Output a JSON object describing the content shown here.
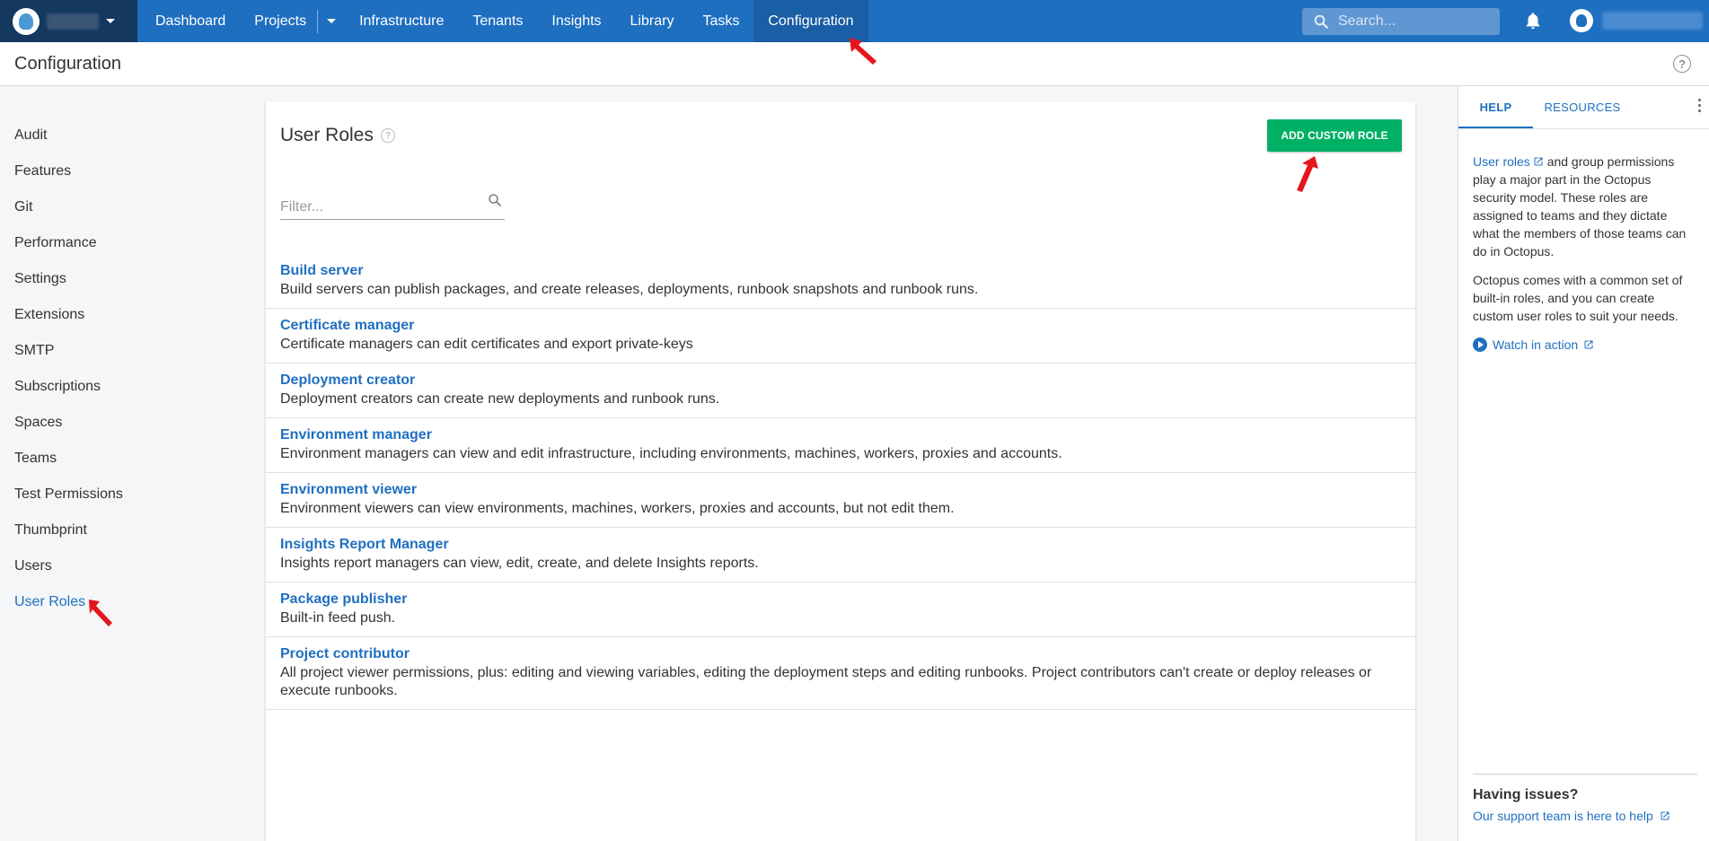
{
  "nav": {
    "items": [
      "Dashboard",
      "Projects",
      "Infrastructure",
      "Tenants",
      "Insights",
      "Library",
      "Tasks",
      "Configuration"
    ],
    "active": "Configuration",
    "search_placeholder": "Search..."
  },
  "header": {
    "title": "Configuration"
  },
  "sidebar": {
    "items": [
      "Audit",
      "Features",
      "Git",
      "Performance",
      "Settings",
      "Extensions",
      "SMTP",
      "Subscriptions",
      "Spaces",
      "Teams",
      "Test Permissions",
      "Thumbprint",
      "Users",
      "User Roles"
    ],
    "active": "User Roles"
  },
  "main": {
    "title": "User Roles",
    "add_button": "ADD CUSTOM ROLE",
    "filter_placeholder": "Filter...",
    "roles": [
      {
        "name": "Build server",
        "description": "Build servers can publish packages, and create releases, deployments, runbook snapshots and runbook runs."
      },
      {
        "name": "Certificate manager",
        "description": "Certificate managers can edit certificates and export private-keys"
      },
      {
        "name": "Deployment creator",
        "description": "Deployment creators can create new deployments and runbook runs."
      },
      {
        "name": "Environment manager",
        "description": "Environment managers can view and edit infrastructure, including environments, machines, workers, proxies and accounts."
      },
      {
        "name": "Environment viewer",
        "description": "Environment viewers can view environments, machines, workers, proxies and accounts, but not edit them."
      },
      {
        "name": "Insights Report Manager",
        "description": "Insights report managers can view, edit, create, and delete Insights reports."
      },
      {
        "name": "Package publisher",
        "description": "Built-in feed push."
      },
      {
        "name": "Project contributor",
        "description": "All project viewer permissions, plus: editing and viewing variables, editing the deployment steps and editing runbooks. Project contributors can't create or deploy releases or execute runbooks."
      }
    ]
  },
  "help_panel": {
    "tabs": [
      "HELP",
      "RESOURCES"
    ],
    "p1_link": "User roles",
    "p1_text": "and group permissions play a major part in the Octopus security model. These roles are assigned to teams and they dictate what the members of those teams can do in Octopus.",
    "p2_text": "Octopus comes with a common set of built-in roles, and you can create custom user roles to suit your needs.",
    "watch_label": "Watch in action",
    "issues_title": "Having issues?",
    "issues_link": "Our support team is here to help"
  },
  "colors": {
    "nav_bg": "#1f6fc1",
    "space_bg": "#14385f",
    "accent": "#1f6fc1",
    "add_button": "#00b065",
    "arrow": "#e5161b"
  }
}
